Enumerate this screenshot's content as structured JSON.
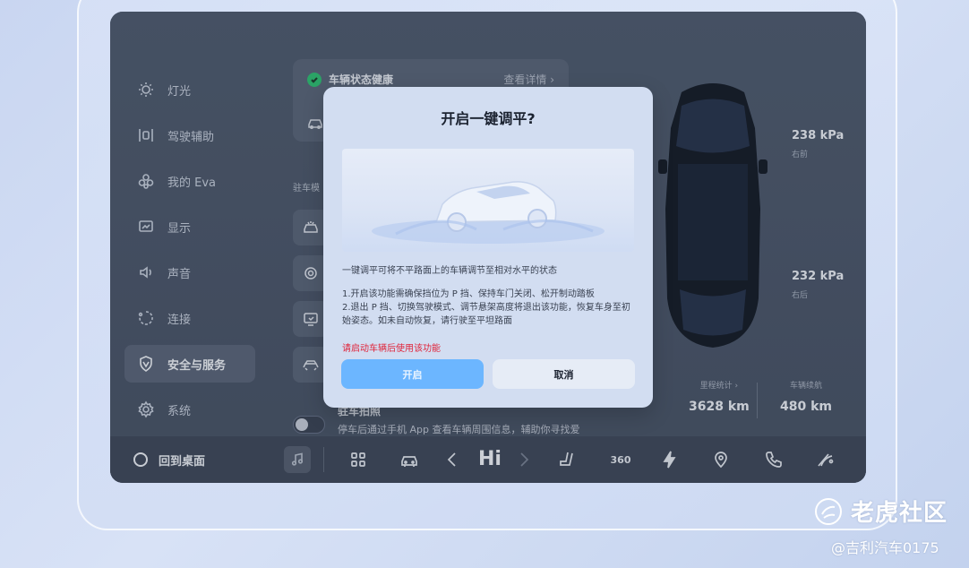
{
  "sidebar": {
    "items": [
      {
        "label": "灯光",
        "icon": "light-icon"
      },
      {
        "label": "驾驶辅助",
        "icon": "lane-assist-icon"
      },
      {
        "label": "我的 Eva",
        "icon": "eva-icon"
      },
      {
        "label": "显示",
        "icon": "display-icon"
      },
      {
        "label": "声音",
        "icon": "speaker-icon"
      },
      {
        "label": "连接",
        "icon": "connection-icon"
      },
      {
        "label": "安全与服务",
        "icon": "shield-icon",
        "active": true
      },
      {
        "label": "系统",
        "icon": "gear-icon"
      }
    ]
  },
  "health": {
    "status": "车辆状态健康",
    "detail": "查看详情"
  },
  "park_section_label": "驻车模",
  "camera": {
    "title": "驻车拍照",
    "description": "停车后通过手机 App 查看车辆周围信息，辅助你寻找爱"
  },
  "tires": {
    "front_right": {
      "pressure": "238 kPa",
      "position": "右前"
    },
    "rear_right": {
      "pressure": "232 kPa",
      "position": "右后"
    }
  },
  "stats": {
    "mileage_label": "里程统计",
    "mileage_value": "3628 km",
    "range_label": "车辆续航",
    "range_value": "480 km"
  },
  "dock": {
    "home_label": "回到桌面",
    "greeting": "Hi",
    "view_360": "360"
  },
  "modal": {
    "title": "开启一键调平?",
    "description": "一键调平可将不平路面上的车辆调节至相对水平的状态",
    "note1": "1.开启该功能需确保挡位为 P 挡、保持车门关闭、松开制动踏板",
    "note2": "2.退出 P 挡、切换驾驶模式、调节悬架高度将退出该功能，恢复车身至初始姿态。如未自动恢复，请行驶至平坦路面",
    "warning": "请启动车辆后使用该功能",
    "confirm_label": "开启",
    "cancel_label": "取消"
  },
  "watermark": {
    "brand": "老虎社区",
    "handle": "@吉利汽车0175"
  },
  "colors": {
    "accent": "#6cb6ff",
    "warning": "#e0243a",
    "healthy": "#2fbf71"
  }
}
